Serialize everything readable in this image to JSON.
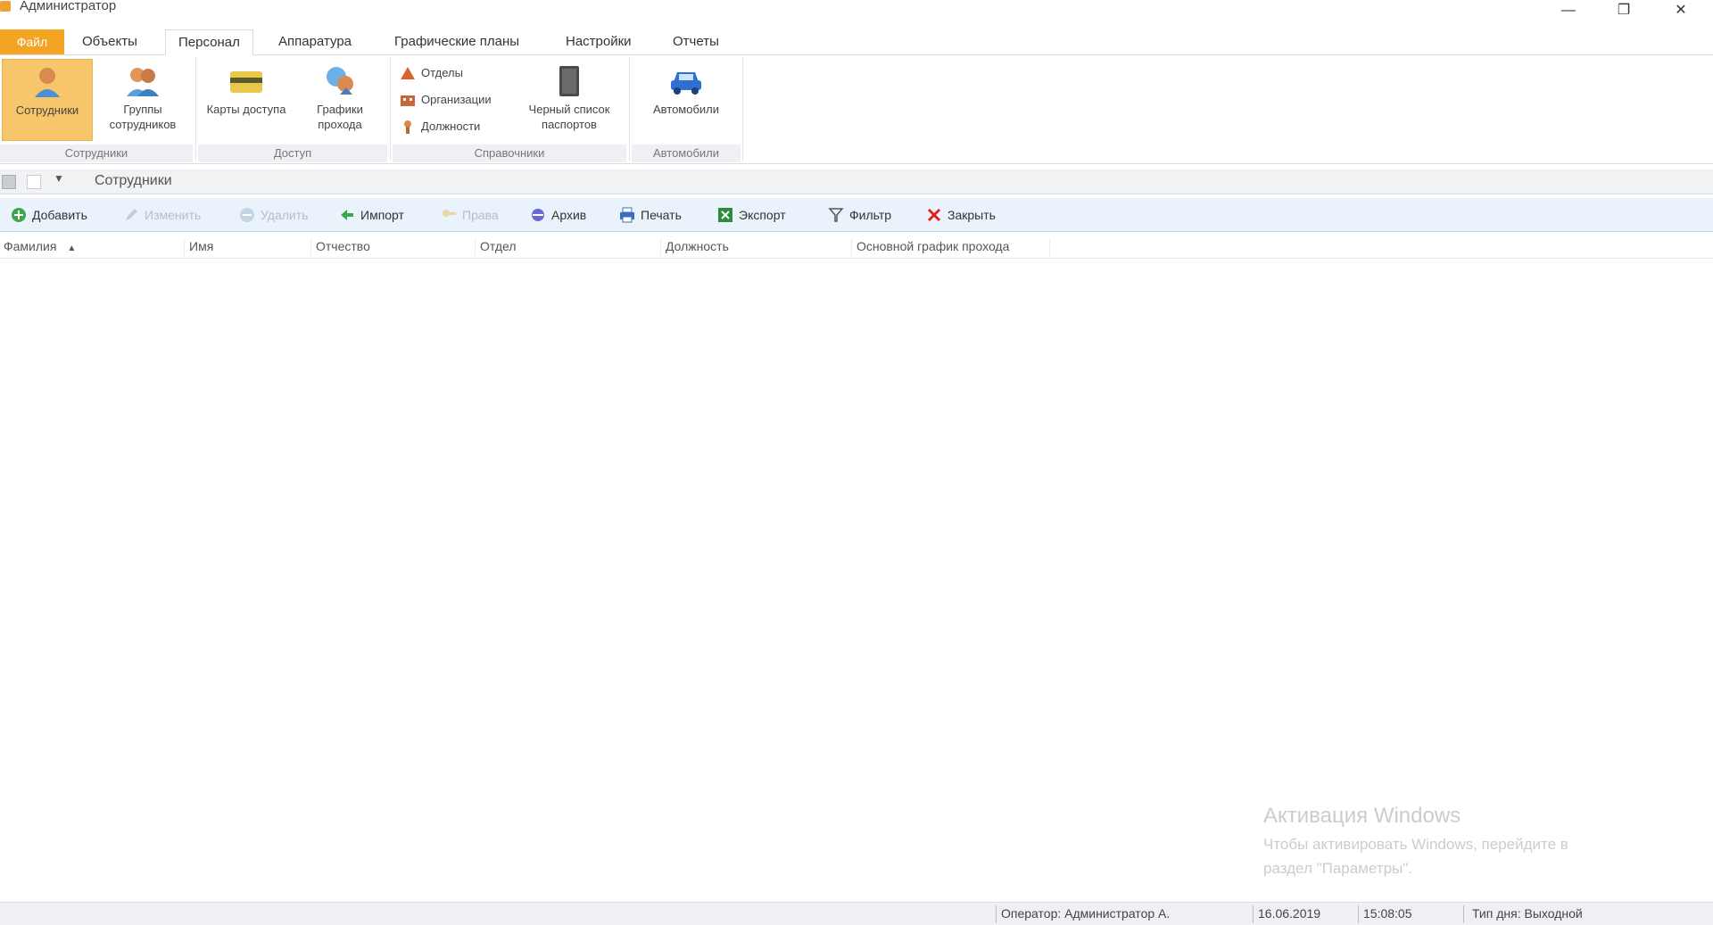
{
  "window": {
    "title": "Администратор",
    "minimize": "—",
    "maximize": "❐",
    "close": "✕"
  },
  "ribbon": {
    "tabs": [
      {
        "label": "Файл"
      },
      {
        "label": "Объекты"
      },
      {
        "label": "Персонал"
      },
      {
        "label": "Аппаратура"
      },
      {
        "label": "Графические планы"
      },
      {
        "label": "Настройки"
      },
      {
        "label": "Отчеты"
      }
    ],
    "active_tab": "Персонал",
    "groups": {
      "employees": {
        "label": "Сотрудники",
        "buttons": [
          "Сотрудники",
          "Группы сотрудников"
        ]
      },
      "access": {
        "label": "Доступ",
        "buttons": [
          "Карты доступа",
          "Графики прохода"
        ]
      },
      "references": {
        "label": "Справочники",
        "small_buttons": [
          "Отделы",
          "Организации",
          "Должности"
        ],
        "big_button": "Черный список паспортов"
      },
      "vehicles": {
        "label": "Автомобили",
        "buttons": [
          "Автомобили"
        ]
      }
    }
  },
  "document": {
    "title": "Сотрудники"
  },
  "toolbar": {
    "add": "Добавить",
    "edit": "Изменить",
    "delete": "Удалить",
    "import": "Импорт",
    "rights": "Права",
    "archive": "Архив",
    "print": "Печать",
    "export": "Экспорт",
    "filter": "Фильтр",
    "close": "Закрыть"
  },
  "grid": {
    "columns": [
      "Фамилия",
      "Имя",
      "Отчество",
      "Отдел",
      "Должность",
      "Основной график прохода"
    ],
    "sort_indicator": "▲",
    "rows": []
  },
  "watermark": {
    "title": "Активация Windows",
    "line1": "Чтобы активировать Windows, перейдите в",
    "line2": "раздел \"Параметры\"."
  },
  "status": {
    "operator": "Оператор: Администратор А.",
    "date": "16.06.2019",
    "time": "15:08:05",
    "day_type": "Тип дня: Выходной"
  },
  "colors": {
    "accent": "#f3a422",
    "selected_button": "#f8c66a",
    "toolbar_bg": "#eaf2fb"
  }
}
